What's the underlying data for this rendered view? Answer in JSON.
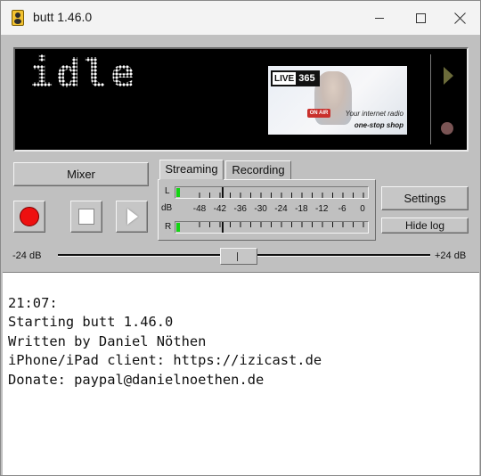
{
  "window": {
    "title": "butt 1.46.0",
    "controls": [
      "minimize",
      "maximize",
      "close"
    ]
  },
  "display": {
    "status_text": "idle",
    "ad": {
      "logo_live": "LIVE",
      "logo_num": "365",
      "badge": "ON AIR",
      "tagline_1": "Your internet radio",
      "tagline_2": "one-stop shop"
    }
  },
  "controls": {
    "mixer_label": "Mixer",
    "tabs": [
      {
        "label": "Streaming",
        "active": true
      },
      {
        "label": "Recording",
        "active": false
      }
    ],
    "settings_label": "Settings",
    "hide_log_label": "Hide log",
    "record_icon": "record-icon",
    "stop_icon": "stop-icon",
    "play_icon": "play-icon"
  },
  "meter": {
    "left_label": "L",
    "right_label": "R",
    "db_label": "dB",
    "scale": [
      "-48",
      "-42",
      "-36",
      "-30",
      "-24",
      "-18",
      "-12",
      "-6",
      "0"
    ],
    "left_level_db": -48,
    "right_level_db": -48
  },
  "gain": {
    "min_label": "-24 dB",
    "max_label": "+24 dB",
    "value_db": 0
  },
  "log": {
    "lines": [
      "21:07:",
      "Starting butt 1.46.0",
      "Written by Daniel Nöthen",
      "iPhone/iPad client: https://izicast.de",
      "Donate: paypal@danielnoethen.de"
    ]
  },
  "colors": {
    "record": "#ee1010",
    "meter_green": "#14d414",
    "lcd_bg": "#000000"
  }
}
